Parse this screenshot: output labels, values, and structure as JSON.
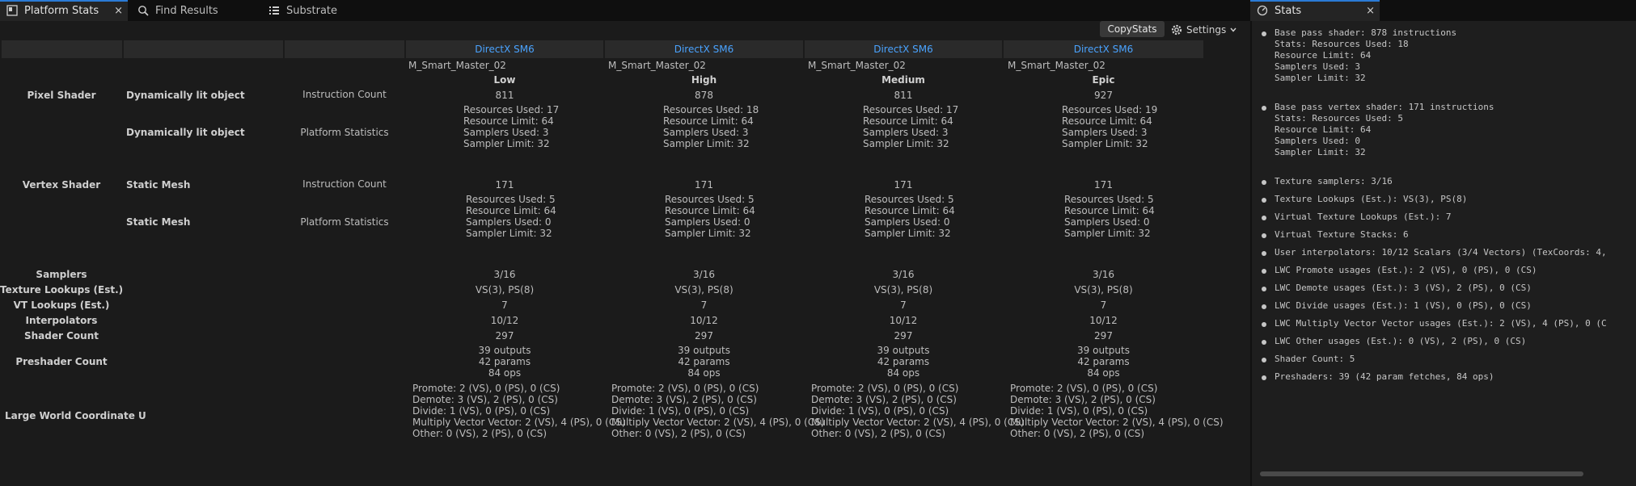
{
  "tabs": [
    {
      "label": "Platform Stats",
      "close": "×"
    },
    {
      "label": "Find Results"
    },
    {
      "label": "Substrate"
    },
    {
      "label": "Stats",
      "close": "×"
    }
  ],
  "toolbar": {
    "copy_label": "CopyStats",
    "settings_label": "Settings"
  },
  "platforms": [
    "DirectX SM6",
    "DirectX SM6",
    "DirectX SM6",
    "DirectX SM6"
  ],
  "materials": [
    "M_Smart_Master_02",
    "M_Smart_Master_02",
    "M_Smart_Master_02",
    "M_Smart_Master_02"
  ],
  "qualities": [
    "Low",
    "High",
    "Medium",
    "Epic"
  ],
  "rows": {
    "pixel_shader": "Pixel Shader",
    "vertex_shader": "Vertex Shader",
    "samplers": "Samplers",
    "texture_lookups": "Texture Lookups (Est.)",
    "vt_lookups": "VT Lookups (Est.)",
    "interpolators": "Interpolators",
    "shader_count": "Shader Count",
    "preshader_count": "Preshader Count",
    "lwc": "Large World Coordinate U"
  },
  "sub": {
    "dyn": "Dynamically lit object",
    "static": "Static Mesh",
    "instr": "Instruction Count",
    "platform": "Platform Statistics"
  },
  "cols": [
    {
      "ps_instr": "811",
      "ps_stats": [
        "Resources Used: 17",
        "Resource Limit: 64",
        "Samplers Used: 3",
        "Sampler Limit: 32"
      ],
      "vs_instr": "171",
      "vs_stats": [
        "Resources Used: 5",
        "Resource Limit: 64",
        "Samplers Used: 0",
        "Sampler Limit: 32"
      ],
      "samplers": "3/16",
      "tex": "VS(3), PS(8)",
      "vt": "7",
      "interp": "10/12",
      "shaders": "297",
      "preshader": [
        "39 outputs",
        "42 params",
        "84 ops"
      ],
      "lwc": [
        "Promote: 2 (VS), 0 (PS), 0 (CS)",
        "Demote: 3 (VS), 2 (PS), 0 (CS)",
        "Divide: 1 (VS), 0 (PS), 0 (CS)",
        "Multiply Vector Vector: 2 (VS), 4 (PS), 0 (CS)",
        "Other: 0 (VS), 2 (PS), 0 (CS)"
      ]
    },
    {
      "ps_instr": "878",
      "ps_stats": [
        "Resources Used: 18",
        "Resource Limit: 64",
        "Samplers Used: 3",
        "Sampler Limit: 32"
      ],
      "vs_instr": "171",
      "vs_stats": [
        "Resources Used: 5",
        "Resource Limit: 64",
        "Samplers Used: 0",
        "Sampler Limit: 32"
      ],
      "samplers": "3/16",
      "tex": "VS(3), PS(8)",
      "vt": "7",
      "interp": "10/12",
      "shaders": "297",
      "preshader": [
        "39 outputs",
        "42 params",
        "84 ops"
      ],
      "lwc": [
        "Promote: 2 (VS), 0 (PS), 0 (CS)",
        "Demote: 3 (VS), 2 (PS), 0 (CS)",
        "Divide: 1 (VS), 0 (PS), 0 (CS)",
        "Multiply Vector Vector: 2 (VS), 4 (PS), 0 (CS)",
        "Other: 0 (VS), 2 (PS), 0 (CS)"
      ]
    },
    {
      "ps_instr": "811",
      "ps_stats": [
        "Resources Used: 17",
        "Resource Limit: 64",
        "Samplers Used: 3",
        "Sampler Limit: 32"
      ],
      "vs_instr": "171",
      "vs_stats": [
        "Resources Used: 5",
        "Resource Limit: 64",
        "Samplers Used: 0",
        "Sampler Limit: 32"
      ],
      "samplers": "3/16",
      "tex": "VS(3), PS(8)",
      "vt": "7",
      "interp": "10/12",
      "shaders": "297",
      "preshader": [
        "39 outputs",
        "42 params",
        "84 ops"
      ],
      "lwc": [
        "Promote: 2 (VS), 0 (PS), 0 (CS)",
        "Demote: 3 (VS), 2 (PS), 0 (CS)",
        "Divide: 1 (VS), 0 (PS), 0 (CS)",
        "Multiply Vector Vector: 2 (VS), 4 (PS), 0 (CS)",
        "Other: 0 (VS), 2 (PS), 0 (CS)"
      ]
    },
    {
      "ps_instr": "927",
      "ps_stats": [
        "Resources Used: 19",
        "Resource Limit: 64",
        "Samplers Used: 3",
        "Sampler Limit: 32"
      ],
      "vs_instr": "171",
      "vs_stats": [
        "Resources Used: 5",
        "Resource Limit: 64",
        "Samplers Used: 0",
        "Sampler Limit: 32"
      ],
      "samplers": "3/16",
      "tex": "VS(3), PS(8)",
      "vt": "7",
      "interp": "10/12",
      "shaders": "297",
      "preshader": [
        "39 outputs",
        "42 params",
        "84 ops"
      ],
      "lwc": [
        "Promote: 2 (VS), 0 (PS), 0 (CS)",
        "Demote: 3 (VS), 2 (PS), 0 (CS)",
        "Divide: 1 (VS), 0 (PS), 0 (CS)",
        "Multiply Vector Vector: 2 (VS), 4 (PS), 0 (CS)",
        "Other: 0 (VS), 2 (PS), 0 (CS)"
      ]
    }
  ],
  "stats_panel": {
    "blocks": [
      [
        "Base pass shader: 878 instructions",
        "Stats: Resources Used: 18",
        "Resource Limit: 64",
        "Samplers Used: 3",
        "Sampler Limit: 32"
      ],
      [
        "Base pass vertex shader: 171 instructions",
        "Stats: Resources Used: 5",
        "Resource Limit: 64",
        "Samplers Used: 0",
        "Sampler Limit: 32"
      ]
    ],
    "items": [
      "Texture samplers: 3/16",
      "Texture Lookups (Est.): VS(3), PS(8)",
      "Virtual Texture Lookups (Est.): 7",
      "Virtual Texture Stacks: 6",
      "User interpolators: 10/12 Scalars (3/4 Vectors) (TexCoords: 4,",
      "LWC Promote usages (Est.): 2 (VS), 0 (PS), 0 (CS)",
      "LWC Demote usages (Est.): 3 (VS), 2 (PS), 0 (CS)",
      "LWC Divide usages (Est.): 1 (VS), 0 (PS), 0 (CS)",
      "LWC Multiply Vector Vector usages (Est.): 2 (VS), 4 (PS), 0 (C",
      "LWC Other usages (Est.): 0 (VS), 2 (PS), 0 (CS)",
      "Shader Count: 5",
      "Preshaders: 39  (42 param fetches, 84 ops)"
    ]
  },
  "colors": {
    "accent": "#2b7bd6",
    "platform_link": "#4aa3ff"
  }
}
